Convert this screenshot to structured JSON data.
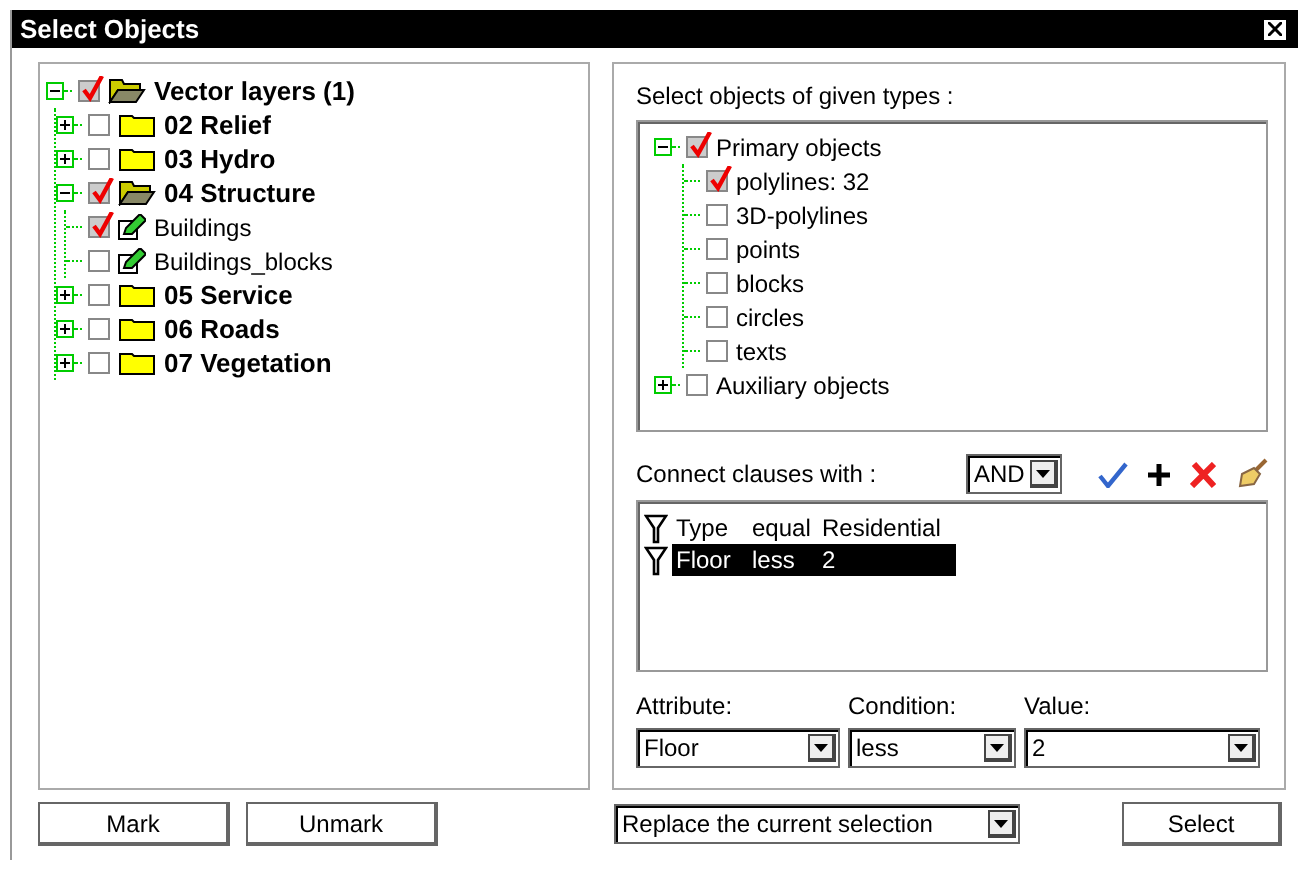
{
  "window": {
    "title": "Select Objects"
  },
  "layers": [
    {
      "label": "Vector layers (1)",
      "kind": "folder",
      "checked": true,
      "expanded": true,
      "children": [
        {
          "label": "02 Relief",
          "kind": "folder",
          "checked": false,
          "expanded": false
        },
        {
          "label": "03 Hydro",
          "kind": "folder",
          "checked": false,
          "expanded": false
        },
        {
          "label": "04 Structure",
          "kind": "folder",
          "checked": true,
          "expanded": true,
          "children": [
            {
              "label": "Buildings",
              "kind": "layer",
              "checked": true
            },
            {
              "label": "Buildings_blocks",
              "kind": "layer",
              "checked": false
            }
          ]
        },
        {
          "label": "05 Service",
          "kind": "folder",
          "checked": false,
          "expanded": false
        },
        {
          "label": "06 Roads",
          "kind": "folder",
          "checked": false,
          "expanded": false
        },
        {
          "label": "07 Vegetation",
          "kind": "folder",
          "checked": false,
          "expanded": false
        }
      ]
    }
  ],
  "types_label": "Select objects of given types :",
  "types": [
    {
      "label": "Primary objects",
      "checked": true,
      "expanded": true,
      "children": [
        {
          "label": "polylines: 32",
          "checked": true
        },
        {
          "label": "3D-polylines",
          "checked": false
        },
        {
          "label": "points",
          "checked": false
        },
        {
          "label": "blocks",
          "checked": false
        },
        {
          "label": "circles",
          "checked": false
        },
        {
          "label": "texts",
          "checked": false
        }
      ]
    },
    {
      "label": "Auxiliary objects",
      "checked": false,
      "expanded": false
    }
  ],
  "connect": {
    "label": "Connect clauses with :",
    "value": "AND"
  },
  "clauses": [
    {
      "attribute": "Type",
      "condition": "equal",
      "value": "Residential",
      "selected": false
    },
    {
      "attribute": "Floor",
      "condition": "less",
      "value": "2",
      "selected": true
    }
  ],
  "editors": [
    {
      "label": "Attribute:",
      "value": "Floor"
    },
    {
      "label": "Condition:",
      "value": "less"
    },
    {
      "label": "Value:",
      "value": "2"
    }
  ],
  "buttons": {
    "mark": "Mark",
    "unmark": "Unmark",
    "select": "Select"
  },
  "mode": {
    "value": "Replace the current selection"
  }
}
